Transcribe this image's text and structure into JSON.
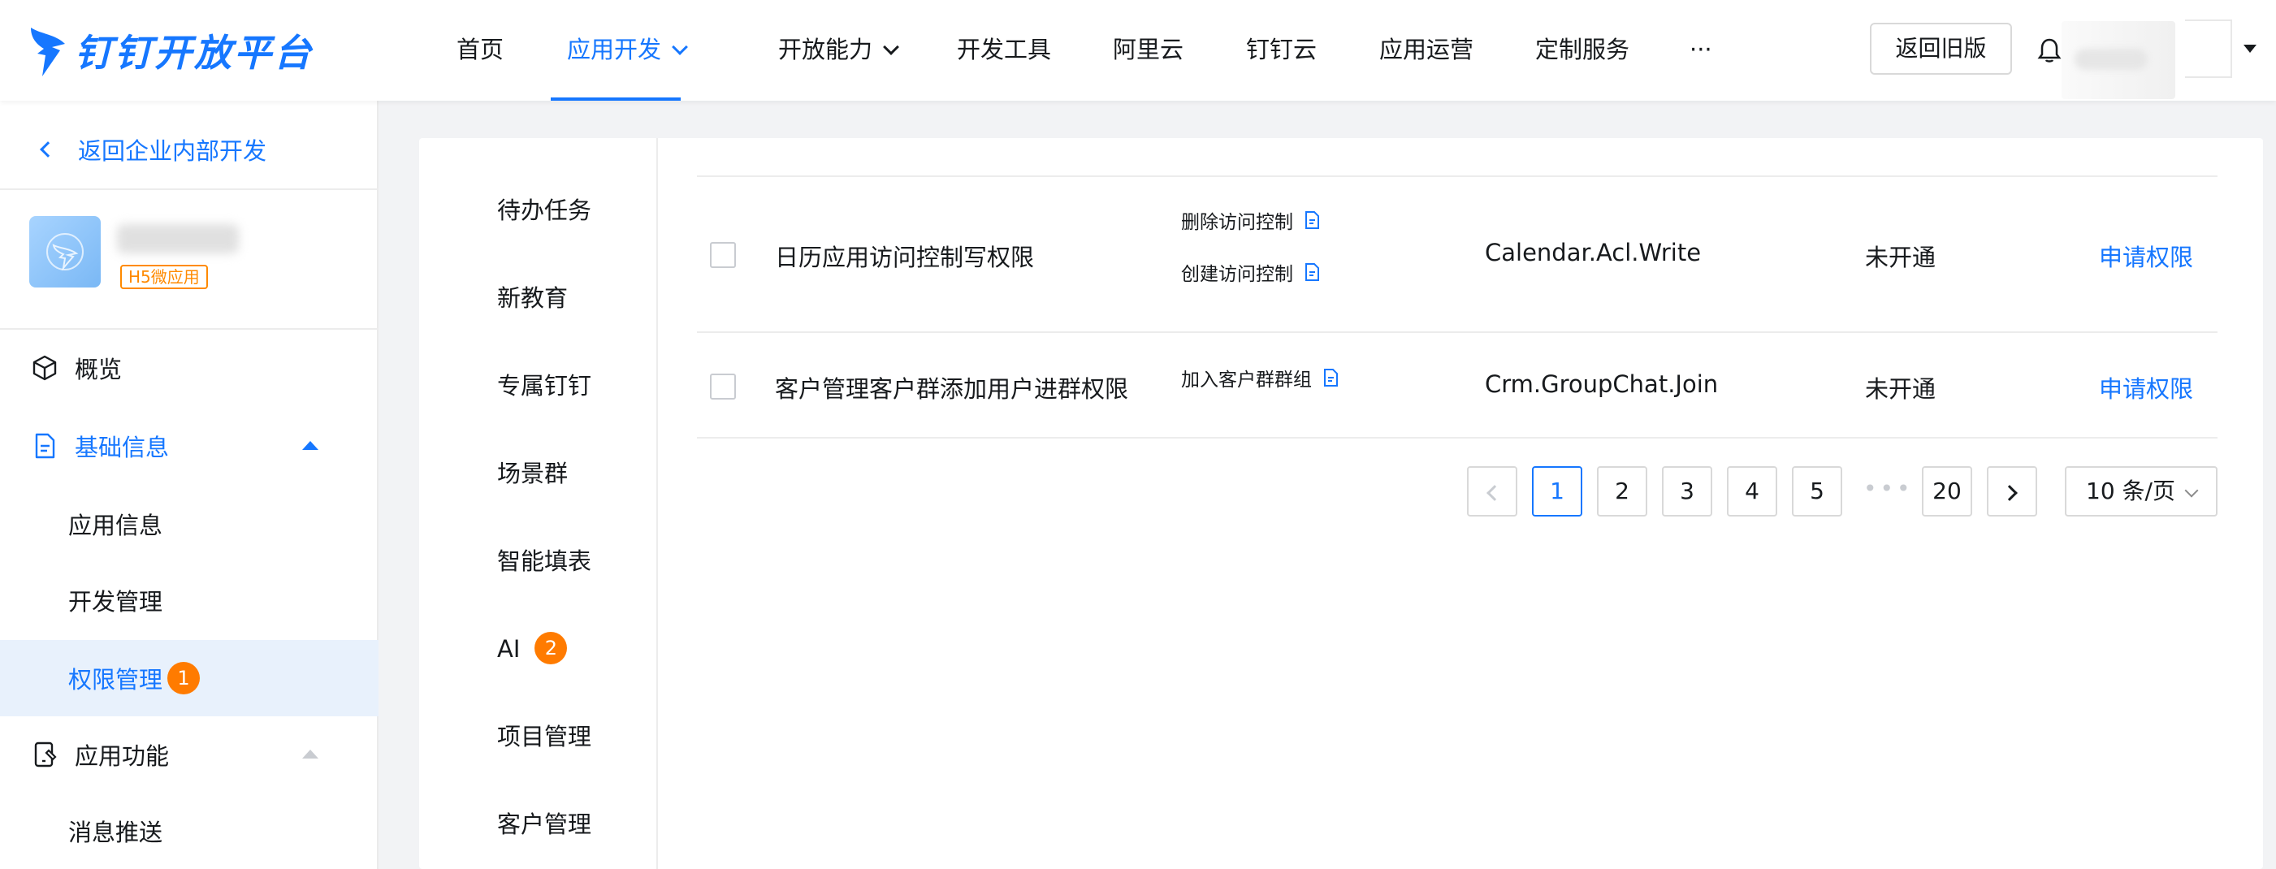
{
  "header": {
    "brand": "钉钉开放平台",
    "nav": [
      {
        "label": "首页"
      },
      {
        "label": "应用开发",
        "active": true,
        "dropdown": true
      },
      {
        "label": "开放能力",
        "dropdown": true
      },
      {
        "label": "开发工具"
      },
      {
        "label": "阿里云"
      },
      {
        "label": "钉钉云"
      },
      {
        "label": "应用运营"
      },
      {
        "label": "定制服务"
      },
      {
        "label": "···"
      }
    ],
    "old_version_button": "返回旧版",
    "accent_color": "#1677ff"
  },
  "sidebar": {
    "back_label": "返回企业内部开发",
    "app_tag": "H5微应用",
    "items": [
      {
        "label": "概览",
        "icon": "cube-icon"
      },
      {
        "label": "基础信息",
        "icon": "document-icon",
        "expanded": true
      },
      {
        "label": "应用信息"
      },
      {
        "label": "开发管理"
      },
      {
        "label": "权限管理",
        "badge": "1",
        "selected": true
      },
      {
        "label": "应用功能",
        "icon": "phone-edit-icon",
        "expanded": true
      },
      {
        "label": "消息推送"
      }
    ]
  },
  "categories": [
    {
      "label": "待办任务"
    },
    {
      "label": "新教育"
    },
    {
      "label": "专属钉钉"
    },
    {
      "label": "场景群"
    },
    {
      "label": "智能填表"
    },
    {
      "label": "AI",
      "badge": "2"
    },
    {
      "label": "项目管理"
    },
    {
      "label": "客户管理"
    }
  ],
  "permissions": [
    {
      "name": "日历应用访问控制写权限",
      "apis": [
        "删除访问控制",
        "创建访问控制"
      ],
      "code": "Calendar.Acl.Write",
      "status": "未开通",
      "action": "申请权限"
    },
    {
      "name": "客户管理客户群添加用户进群权限",
      "apis": [
        "加入客户群群组"
      ],
      "code": "Crm.GroupChat.Join",
      "status": "未开通",
      "action": "申请权限"
    }
  ],
  "pagination": {
    "pages": [
      "1",
      "2",
      "3",
      "4",
      "5"
    ],
    "ellipsis": "•••",
    "last": "20",
    "current": "1",
    "page_size": "10 条/页"
  }
}
